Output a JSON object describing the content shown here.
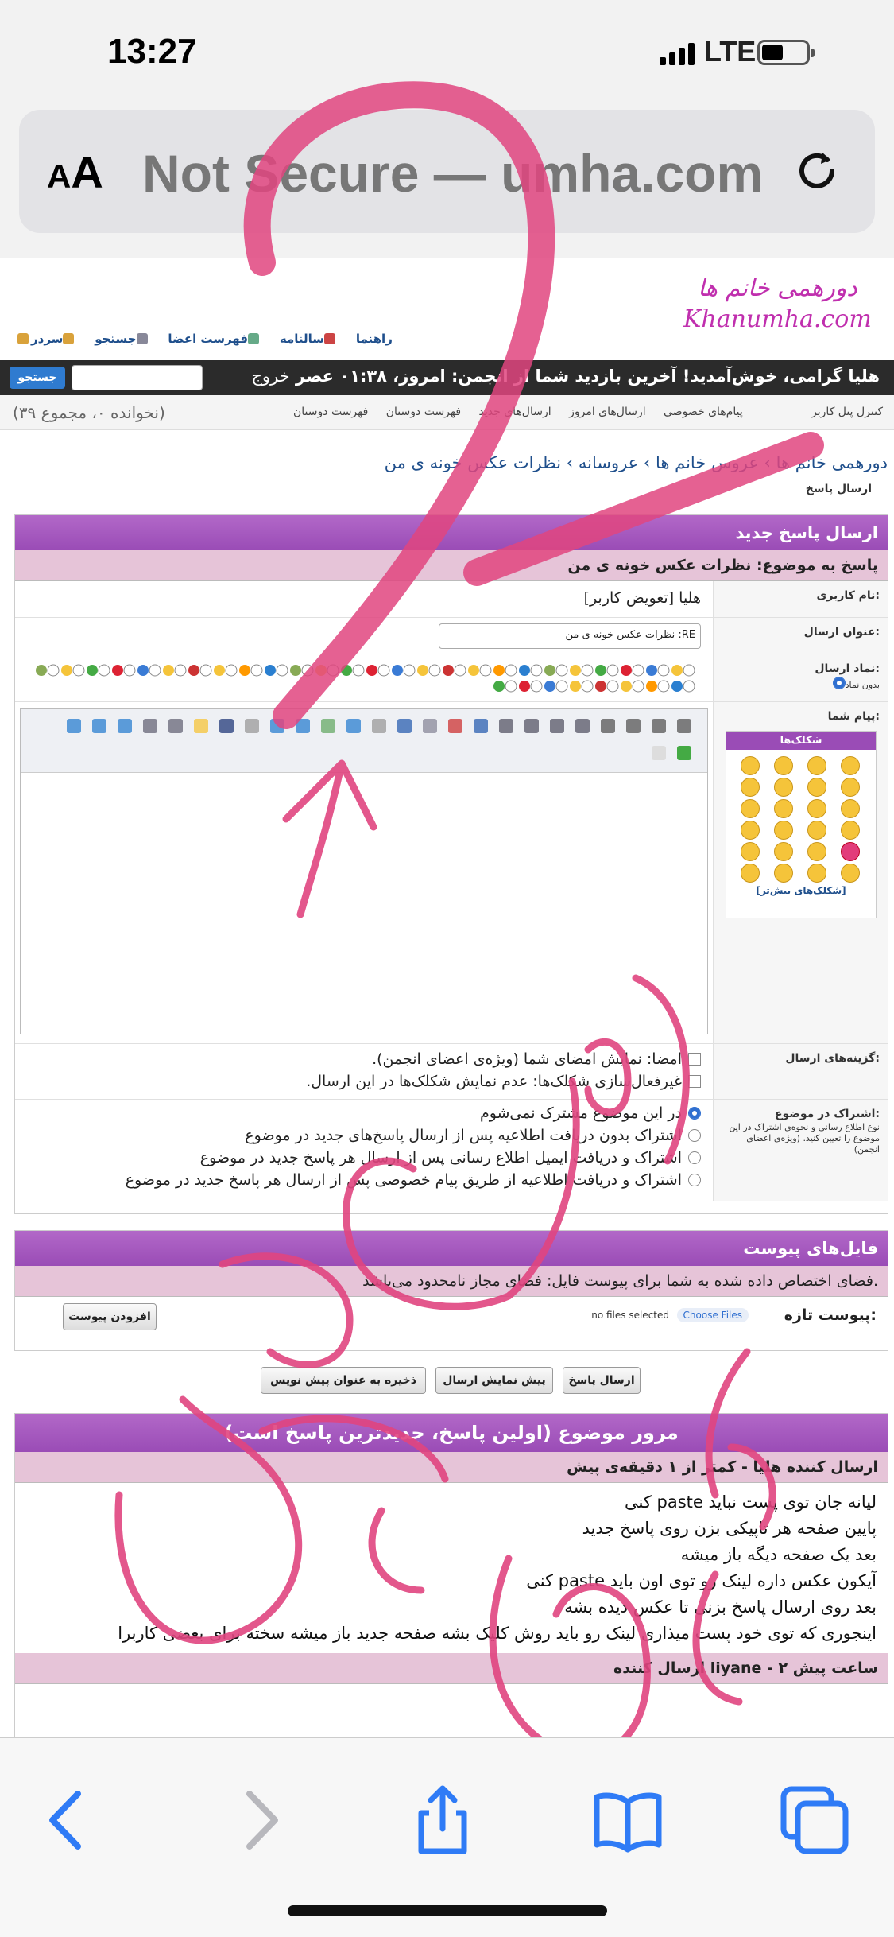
{
  "status": {
    "time": "13:27",
    "network": "LTE"
  },
  "browser": {
    "aa_label": "AA",
    "url_text": "Not Secure — ",
    "url_domain": "umha.com"
  },
  "site": {
    "logo_fa": "دورهمی خانم ها",
    "logo_en": "Khanumha.com",
    "top_links": [
      "راهنما",
      "سالنامه",
      "فهرست اعضا",
      "جستجو",
      "سردر"
    ],
    "search_button": "جستجو",
    "welcome": "هلیا گرامی، خوش‌آمدید! آخرین بازدید شما از انجمن: امروز، ۰۱:۳۸ عصر",
    "logout": "خروج",
    "subnav_right": "کنترل پنل کاربر",
    "subnav_items": [
      "فهرست دوستان",
      "فهرست دوستان",
      "ارسال‌های جدید",
      "ارسال‌های امروز",
      "پیام‌های خصوصی"
    ],
    "subnav_left": "(نخوانده ۰، مجموع ۳۹)"
  },
  "breadcrumb": {
    "path": "دورهمی خانم ها › عروس خانم ها › عروسانه › نظرات عکس خونه ی من",
    "current": "ارسال پاسخ"
  },
  "reply_form": {
    "header": "ارسال پاسخ جدید",
    "subheader": "پاسخ به موضوع: نظرات عکس خونه ی من",
    "username_label": "نام کاربری:",
    "username_value": "هلیا [تعویض کاربر]",
    "title_label": "عنوان ارسال:",
    "title_value": "RE: نظرات عکس خونه ی من",
    "icon_label": "نماد ارسال:",
    "icon_none": "بدون نماد",
    "message_label": "پیام شما:",
    "smilies_header": "شکلک‌ها",
    "smilies_more": "[شکلک‌های بیش‌تر]",
    "options_label": "گزینه‌های ارسال:",
    "option_signature": "امضا: نمایش امضای شما (ویژه‌ی اعضای انجمن).",
    "option_disable_smilies": "غیرفعال‌سازی شکلک‌ها: عدم نمایش شکلک‌ها در این ارسال.",
    "subscribe_label": "اشتراک در موضوع:",
    "subscribe_desc": "نوع اطلاع رسانی و نحوه‌ی اشتراک در این موضوع را تعیین کنید. (ویژه‌ی اعضای انجمن)",
    "subscribe_options": [
      "در این موضوع مشترک نمی‌شوم",
      "اشتراک بدون دریافت اطلاعیه پس از ارسال پاسخ‌های جدید در موضوع",
      "اشتراک و دریافت ایمیل اطلاع رسانی پس از ارسال هر پاسخ جدید در موضوع",
      "اشتراک و دریافت اطلاعیه از طریق پیام خصوصی پس از ارسال هر پاسخ جدید در موضوع"
    ]
  },
  "attachments": {
    "header": "فایل‌های پیوست",
    "quota": "فضای اختصاص داده شده به شما برای پیوست فایل: فضای مجاز نامحدود می‌باشد.",
    "new_label": "پیوست تازه:",
    "choose_files": "Choose Files",
    "no_files": "no files selected",
    "add_button": "افزودن پیوست"
  },
  "buttons": {
    "submit": "ارسال پاسخ",
    "preview": "پیش نمایش ارسال",
    "save_draft": "ذخیره به عنوان پیش نویس"
  },
  "review": {
    "header": "مرور موضوع (اولین پاسخ، جدیدترین پاسخ است)",
    "post1_author": "ارسال کننده هلیا - کمتر از ۱ دقیقه‌ی پیش",
    "post1_lines": [
      "لیانه جان توی پست نباید paste کنی",
      "پایین صفحه هر تاپیکی بزن روی پاسخ جدید",
      "بعد یک صفحه دیگه باز میشه",
      "آیکون عکس داره لینک رو توی اون باید paste کنی",
      "بعد روی ارسال پاسخ بزنی تا عکس دیده بشه",
      "اینجوری که توی خود پست میذاری لینک رو باید روش کلیک بشه صفحه جدید باز میشه سخته برای بعضی کاربرا"
    ],
    "post2_author": "ارسال کننده liyane - ۲ ساعت پیش"
  }
}
